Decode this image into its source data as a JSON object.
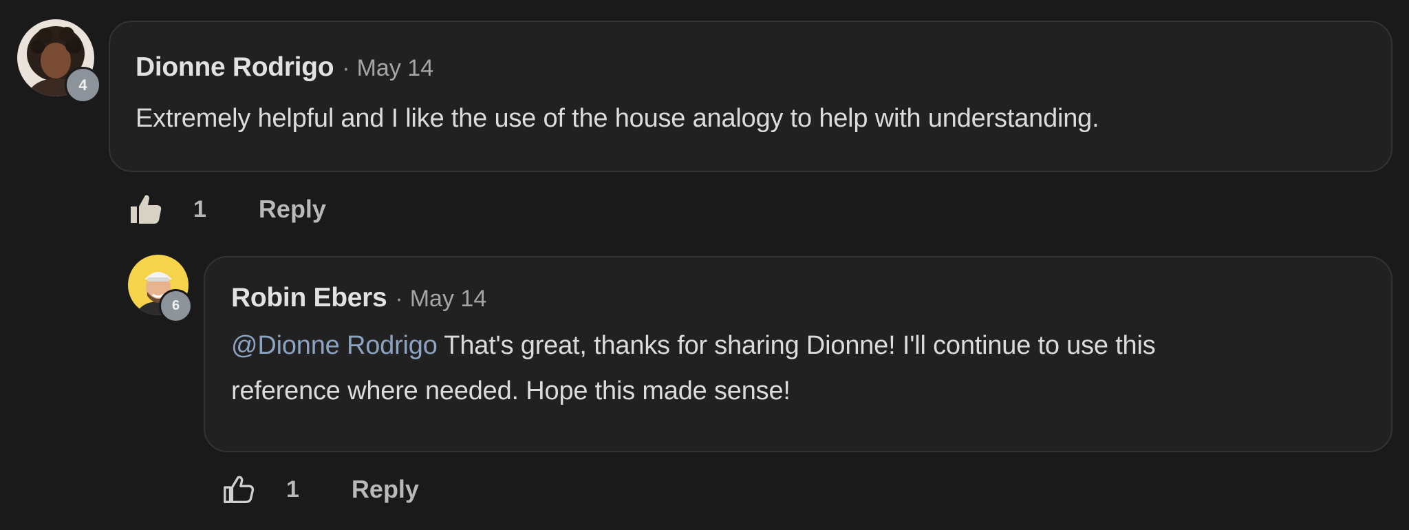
{
  "comments": [
    {
      "author": "Dionne Rodrigo",
      "separator": "·",
      "date": "May 14",
      "level": "4",
      "text": "Extremely helpful and I like the use of the house analogy to help with understanding.",
      "likes": "1",
      "liked": true,
      "reply_label": "Reply"
    },
    {
      "author": "Robin Ebers",
      "separator": "·",
      "date": "May 14",
      "level": "6",
      "mention": "@Dionne Rodrigo",
      "text_line1": " That's great, thanks for sharing Dionne! I'll continue to use this",
      "text_line2": "reference where needed. Hope this made sense!",
      "likes": "1",
      "liked": false,
      "reply_label": "Reply"
    }
  ],
  "colors": {
    "background": "#1a1a1b",
    "bubble": "#212122",
    "mention": "#8da3c2",
    "badge": "#8d939b",
    "liked_thumb": "#d8d2c4"
  },
  "icons": {
    "liked": "thumbs-up-filled-icon",
    "not_liked": "thumbs-up-outline-icon"
  }
}
